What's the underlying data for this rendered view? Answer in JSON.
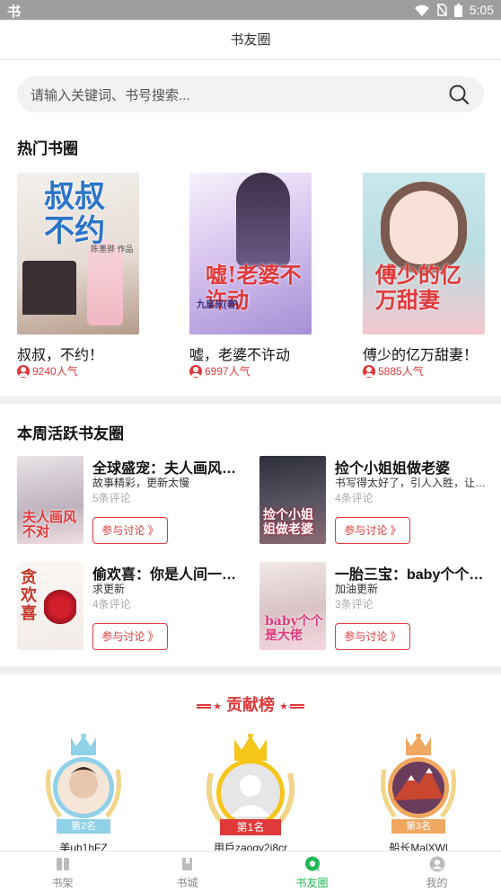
{
  "status_bar": {
    "time": "5:05"
  },
  "header": {
    "title": "书友圈"
  },
  "search": {
    "placeholder": "请输入关键词、书号搜索..."
  },
  "hot_section": {
    "title": "热门书圈",
    "books": [
      {
        "name": "叔叔，不约！",
        "popularity": "9240人气",
        "cover_text": "叔叔不约",
        "cover_author": "陈墨骅 作品"
      },
      {
        "name": "嘘，老婆不许动",
        "popularity": "6997人气",
        "cover_text": "嘘!老婆不许动",
        "cover_author": "九皇叔(著)"
      },
      {
        "name": "傅少的亿万甜妻！",
        "popularity": "5885人气",
        "cover_text": "傅少的亿万甜妻",
        "cover_author": ""
      }
    ]
  },
  "active_section": {
    "title": "本周活跃书友圈",
    "items": [
      {
        "name": "全球盛宠：夫人画风…",
        "desc": "故事精彩，更新太慢",
        "count": "5条评论",
        "button": "参与讨论 》",
        "cover_text": "夫人画风不对"
      },
      {
        "name": "捡个小姐姐做老婆",
        "desc": "书写得太好了，引人入胜，让…",
        "count": "4条评论",
        "button": "参与讨论 》",
        "cover_text": "捡个小姐姐做老婆"
      },
      {
        "name": "偷欢喜：你是人间一…",
        "desc": "求更新",
        "count": "4条评论",
        "button": "参与讨论 》",
        "cover_text": "贪欢喜"
      },
      {
        "name": "一胎三宝：baby个个…",
        "desc": "加油更新",
        "count": "3条评论",
        "button": "参与讨论 》",
        "cover_text": "baby个个是大佬"
      }
    ]
  },
  "ranking": {
    "title": "贡献榜",
    "users": [
      {
        "rank_label": "第2名",
        "name": "美uh1hFZ",
        "color": "#8fd1e8"
      },
      {
        "rank_label": "第1名",
        "name": "用戶zaoqy2j8cr",
        "color": "#f5c518"
      },
      {
        "rank_label": "第3名",
        "name": "船长MalXWl",
        "color": "#f0a860"
      }
    ]
  },
  "tabbar": {
    "tabs": [
      {
        "label": "书架",
        "icon": "bookshelf-icon",
        "active": false
      },
      {
        "label": "书城",
        "icon": "bookstore-icon",
        "active": false
      },
      {
        "label": "书友圈",
        "icon": "chat-icon",
        "active": true
      },
      {
        "label": "我的",
        "icon": "profile-icon",
        "active": false
      }
    ]
  },
  "colors": {
    "accent": "#e0393a",
    "tab_active": "#1db954",
    "divider": "#f0f0f0"
  }
}
